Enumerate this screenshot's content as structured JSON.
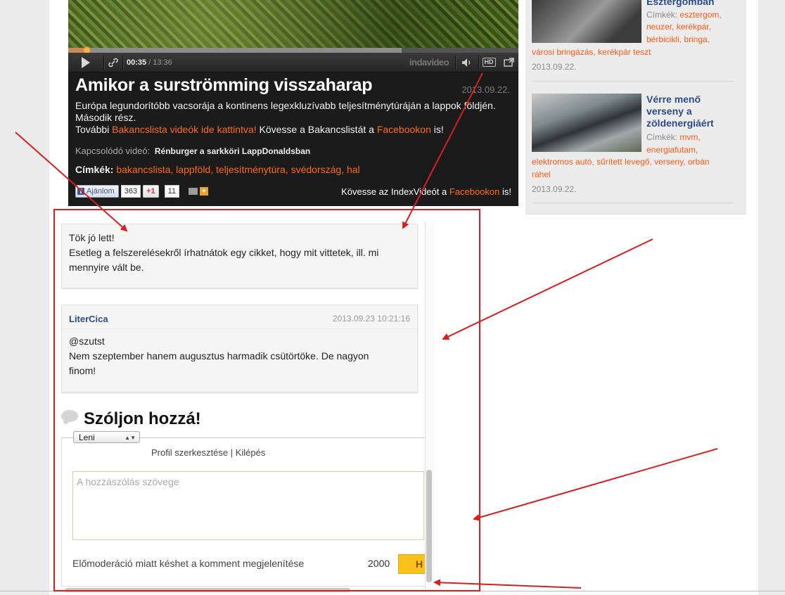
{
  "video": {
    "current_time": "00:35",
    "time_separator": "/",
    "total_time": "13:36",
    "brand": "indavideo",
    "hd_label": "HD",
    "progress_fraction": 0.04,
    "loaded_fraction": 0.74,
    "title": "Amikor a surströmming visszaharap",
    "date": "2013.09.22.",
    "description": "Európa legundorítóbb vacsorája a kontinens legexkluzívabb teljesítménytúráján a lappok földjén. Második rész.",
    "more_prefix": "További ",
    "more_link": "Bakancslista videók ide kattintva!",
    "more_mid": " Kövesse a Bakancslistát a ",
    "more_fb": "Facebookon",
    "more_suffix": " is!",
    "related_label": "Kapcsolódó videó:",
    "related_title": "Rénburger a sarkköri LappDonaldsban",
    "tags_label": "Címkék:",
    "tags": "bakancslista, lappföld, teljesítménytúra, svédország, hal",
    "like_label": "Ajánlom",
    "like_count": "363",
    "gplus_label": "+1",
    "gplus_count": "11",
    "follow_prefix": "Kövesse az IndexVideót a ",
    "follow_link": "Facebookon",
    "follow_suffix": " is!"
  },
  "sidebar": {
    "items": [
      {
        "title": "Esztergomban",
        "tags_label": "Címkék:",
        "tags_line1": "esztergom,",
        "tags_line2": "neuzer, kerékpár,",
        "tags_line3": "bérbicikli, bringa,",
        "tags_line4": "városi bringázás, kerékpár teszt",
        "date": "2013.09.22."
      },
      {
        "title": "Vérre menő verseny a zöldenergiáért",
        "tags_label": "Címkék:",
        "tags_line1": "mvm,",
        "tags_line2": "energiafutam,",
        "tags_line3": "elektromos autó, sűrített levegő, verseny, orbán",
        "tags_line4": "ráhel",
        "date": "2013.09.22."
      }
    ]
  },
  "comments": [
    {
      "author": "",
      "date": "",
      "lines": [
        "Tök jó lett!",
        "Esetleg a felszerelésekről írhatnátok egy cikket, hogy mit vittetek, ill. mi",
        "mennyire vált be."
      ]
    },
    {
      "author": "LiterCica",
      "date": "2013.09.23 10:21:16",
      "lines": [
        "@szutst",
        "Nem szeptember hanem augusztus harmadik csütörtöke. De nagyon",
        "finom!"
      ]
    }
  ],
  "comment_form": {
    "heading": "Szóljon hozzá!",
    "user_select": "Leni",
    "edit_profile": "Profil szerkesztése",
    "link_separator": " | ",
    "logout": "Kilépés",
    "textarea_placeholder": "A hozzászólás szövege",
    "premoderation_note": "Előmoderáció miatt késhet a komment megjelenítése",
    "char_count": "2000",
    "submit_label": "H"
  },
  "colors": {
    "link_orange": "#ff6a1f",
    "title_blue": "#2c4a8a",
    "annotation_red": "#d81f1f",
    "submit_yellow": "#f8c21b"
  }
}
